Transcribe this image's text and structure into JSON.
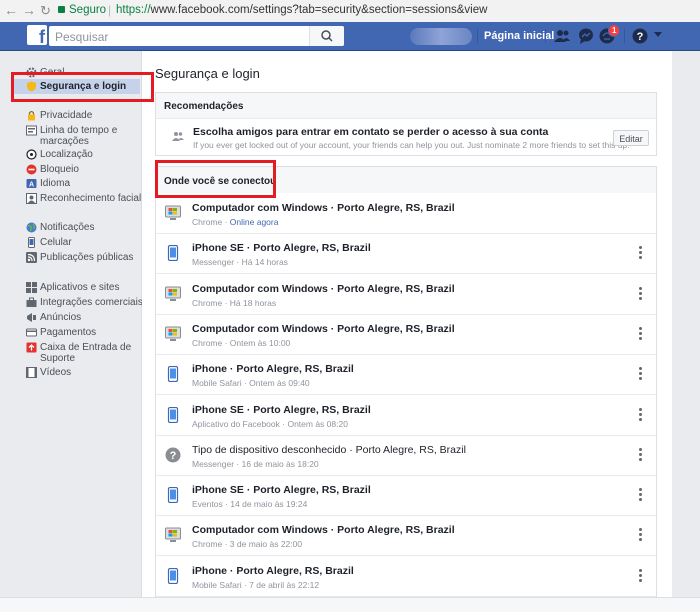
{
  "browser": {
    "secure_label": "Seguro",
    "url_scheme": "https://",
    "url_rest": "www.facebook.com/settings?tab=security&section=sessions&view"
  },
  "topbar": {
    "logo": "f",
    "search_placeholder": "Pesquisar",
    "home_label": "Página inicial",
    "notification_count": "1",
    "icons": [
      "friend-requests-icon",
      "messenger-icon",
      "notifications-icon",
      "help-icon",
      "account-menu-icon"
    ]
  },
  "sidebar": {
    "items": [
      {
        "label": "Geral",
        "icon": "gear-icon"
      },
      {
        "label": "Segurança e login",
        "icon": "security-shield-icon",
        "selected": true
      },
      {
        "label": "Privacidade",
        "icon": "privacy-lock-icon"
      },
      {
        "label": "Linha do tempo e marcações",
        "icon": "timeline-icon"
      },
      {
        "label": "Localização",
        "icon": "location-icon"
      },
      {
        "label": "Bloqueio",
        "icon": "block-icon"
      },
      {
        "label": "Idioma",
        "icon": "language-icon"
      },
      {
        "label": "Reconhecimento facial",
        "icon": "face-recognition-icon"
      },
      {
        "label": "Notificações",
        "icon": "globe-icon"
      },
      {
        "label": "Celular",
        "icon": "mobile-icon"
      },
      {
        "label": "Publicações públicas",
        "icon": "rss-icon"
      },
      {
        "label": "Aplicativos e sites",
        "icon": "apps-icon"
      },
      {
        "label": "Integrações comerciais",
        "icon": "business-icon"
      },
      {
        "label": "Anúncios",
        "icon": "ads-icon"
      },
      {
        "label": "Pagamentos",
        "icon": "payments-icon"
      },
      {
        "label": "Caixa de Entrada de Suporte",
        "icon": "support-inbox-icon"
      },
      {
        "label": "Vídeos",
        "icon": "video-icon"
      }
    ]
  },
  "main": {
    "title": "Segurança e login",
    "recommendations": {
      "header": "Recomendações",
      "title": "Escolha amigos para entrar em contato se perder o acesso à sua conta",
      "subtitle": "If you ever get locked out of your account, your friends can help you out. Just nominate 2 more friends to set this up.",
      "button": "Editar"
    },
    "sessions_header": "Onde você se conectou",
    "sessions": [
      {
        "device": "Computador com Windows",
        "location": " · Porto Alegre, RS, Brazil",
        "app": "Chrome",
        "time": "Online agora",
        "online": true,
        "icon": "windows-computer-icon"
      },
      {
        "device": "iPhone SE",
        "location": " · Porto Alegre, RS, Brazil",
        "app": "Messenger",
        "time": "Há 14 horas",
        "icon": "phone-icon"
      },
      {
        "device": "Computador com Windows",
        "location": " · Porto Alegre, RS, Brazil",
        "app": "Chrome",
        "time": "Há 18 horas",
        "icon": "windows-computer-icon"
      },
      {
        "device": "Computador com Windows",
        "location": " · Porto Alegre, RS, Brazil",
        "app": "Chrome",
        "time": "Ontem às 10:00",
        "icon": "windows-computer-icon"
      },
      {
        "device": "iPhone",
        "location": " · Porto Alegre, RS, Brazil",
        "app": "Mobile Safari",
        "time": "Ontem às 09:40",
        "icon": "phone-icon"
      },
      {
        "device": "iPhone SE",
        "location": " · Porto Alegre, RS, Brazil",
        "app": "Aplicativo do Facebook",
        "time": "Ontem às 08:20",
        "icon": "phone-icon"
      },
      {
        "device": "Tipo de dispositivo desconhecido",
        "location": " · Porto Alegre, RS, Brazil",
        "app": "Messenger",
        "time": "16 de maio às 18:20",
        "icon": "unknown-device-icon"
      },
      {
        "device": "iPhone SE",
        "location": " · Porto Alegre, RS, Brazil",
        "app": "Eventos",
        "time": "14 de maio às 19:24",
        "icon": "phone-icon"
      },
      {
        "device": "Computador com Windows",
        "location": " · Porto Alegre, RS, Brazil",
        "app": "Chrome",
        "time": "3 de maio às 22:00",
        "icon": "windows-computer-icon"
      },
      {
        "device": "iPhone",
        "location": " · Porto Alegre, RS, Brazil",
        "app": "Mobile Safari",
        "time": "7 de abril às 22:12",
        "icon": "phone-icon"
      }
    ],
    "meta_separator": " · "
  },
  "colors": {
    "fb_blue": "#4267b2",
    "highlight_red": "#e21c22",
    "selected_bg": "#c5d2e9"
  }
}
